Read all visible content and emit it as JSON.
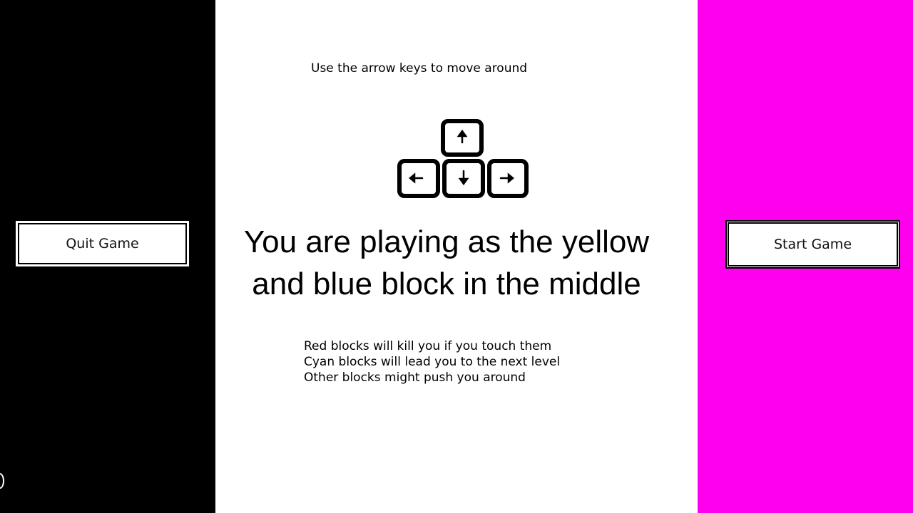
{
  "colors": {
    "left_panel": "#000000",
    "center_panel": "#ffffff",
    "right_panel": "#ff00ee",
    "button_bg": "#ffffff",
    "text": "#000000"
  },
  "buttons": {
    "quit_label": "Quit Game",
    "start_label": "Start Game"
  },
  "instructions": {
    "arrow_hint": "Use the arrow keys to move around",
    "keys_icon": "arrow-keys-icon",
    "headline_line1": "You are playing as the yellow",
    "headline_line2": "and blue block in the middle",
    "rules": [
      "Red blocks will kill you if you touch them",
      "Cyan blocks will lead you to the next level",
      "Other blocks might push you around"
    ]
  }
}
